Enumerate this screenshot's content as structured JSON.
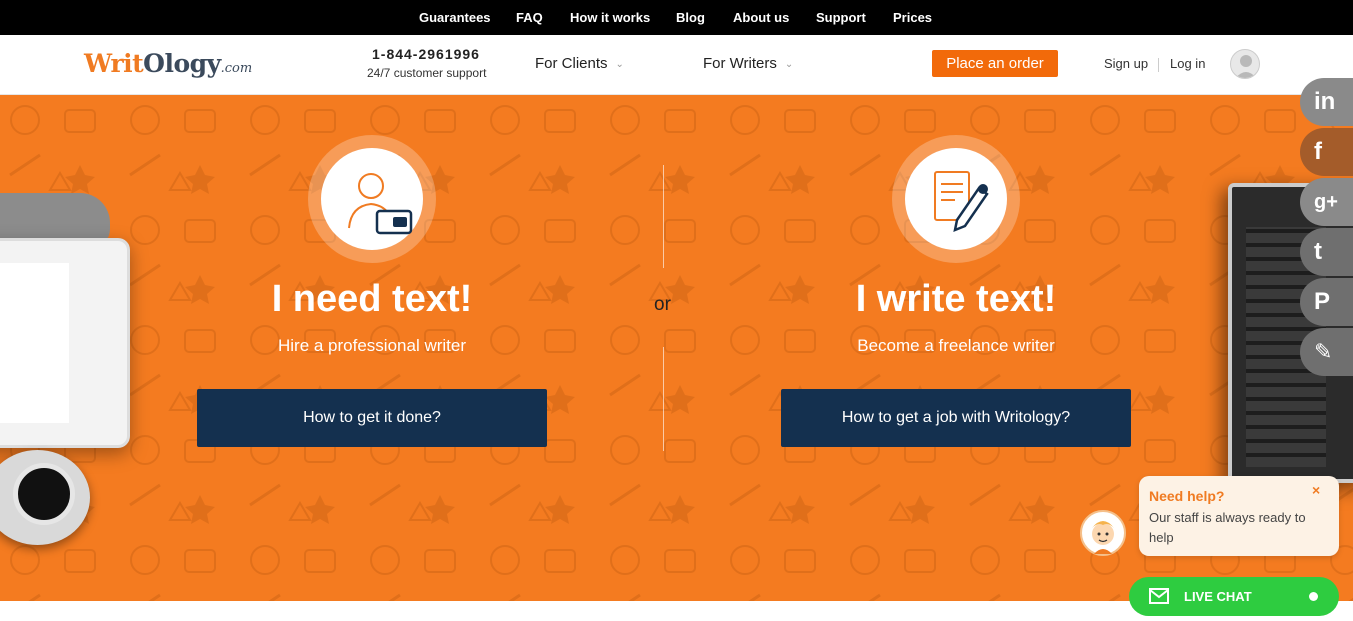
{
  "topnav": {
    "items": [
      "Guarantees",
      "FAQ",
      "How it works",
      "Blog",
      "About us",
      "Support",
      "Prices"
    ]
  },
  "header": {
    "logo": {
      "part1": "Writ",
      "part2": "Ology",
      "part3": ".com"
    },
    "phone": "1-844-2961996",
    "support_text": "24/7 customer support",
    "nav": [
      {
        "label": "For Clients"
      },
      {
        "label": "For Writers"
      }
    ],
    "order_label": "Place an order",
    "signup_label": "Sign up",
    "login_label": "Log in"
  },
  "hero": {
    "or_text": "or",
    "left": {
      "icon": "client-wallet-icon",
      "title": "I need text!",
      "subtitle": "Hire a professional writer",
      "button": "How to get it done?"
    },
    "right": {
      "icon": "document-pen-icon",
      "title": "I write text!",
      "subtitle": "Become a freelance writer",
      "button": "How to get a job with Writology?"
    },
    "background_color": "#f47b20",
    "button_color": "#14304f"
  },
  "social": [
    {
      "name": "linkedin-icon",
      "glyph": "in",
      "color": "#8a8a8a"
    },
    {
      "name": "facebook-icon",
      "glyph": "f",
      "color": "#a45c2a"
    },
    {
      "name": "google-plus-icon",
      "glyph": "g+",
      "color": "#8a8a8a"
    },
    {
      "name": "tumblr-icon",
      "glyph": "t",
      "color": "#8a8a8a"
    },
    {
      "name": "pinterest-icon",
      "glyph": "P",
      "color": "#8a8a8a"
    },
    {
      "name": "edit-icon",
      "glyph": "✎",
      "color": "#8a8a8a"
    }
  ],
  "chat": {
    "title": "Need help?",
    "close": "×",
    "text": "Our staff is always ready to help",
    "button_label": "LIVE CHAT"
  },
  "colors": {
    "accent": "#f26a0a",
    "dark": "#14304f",
    "chat_green": "#2ecc40"
  }
}
